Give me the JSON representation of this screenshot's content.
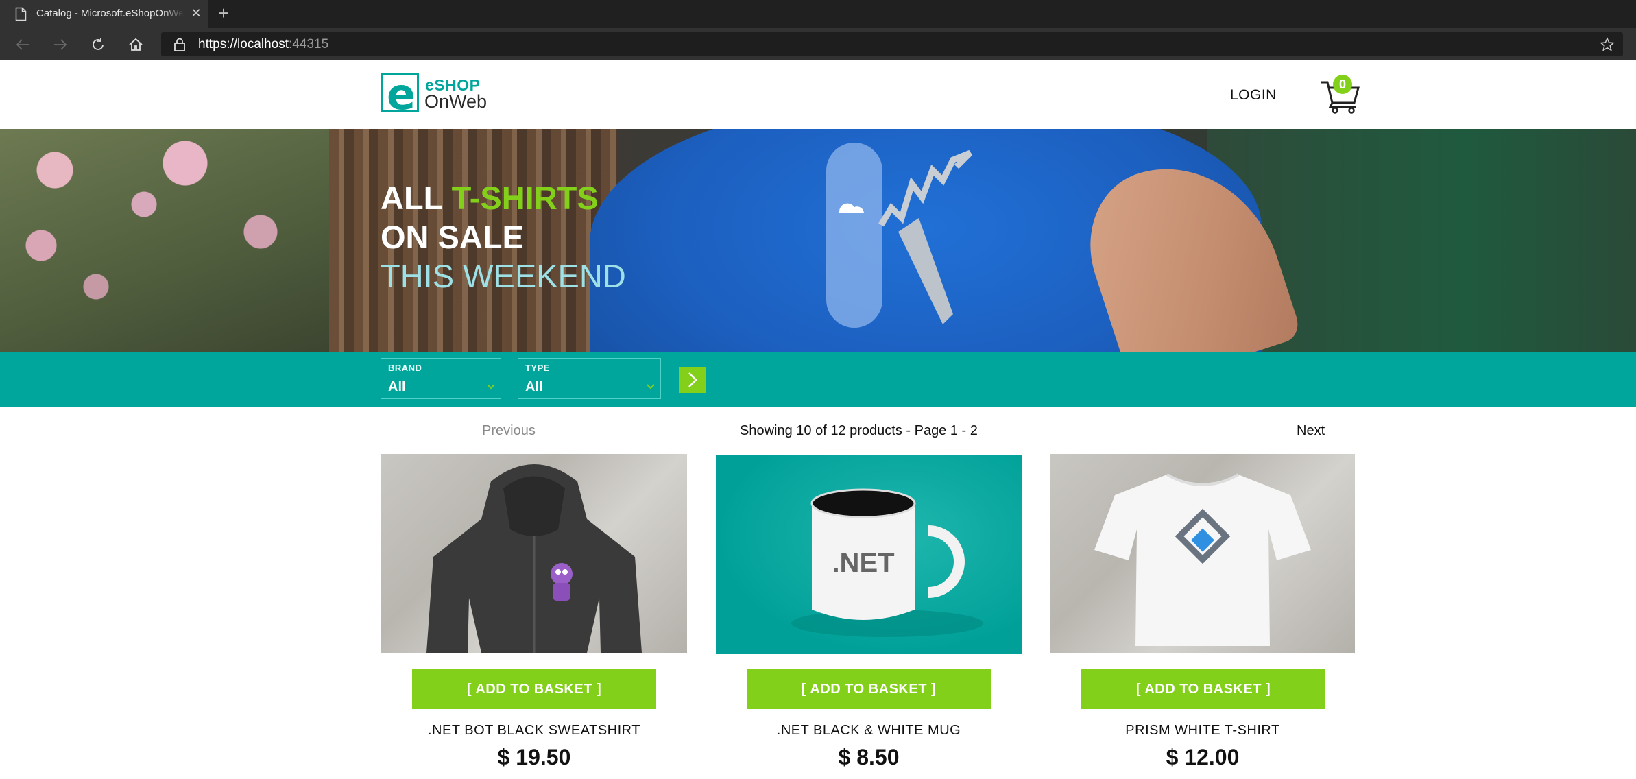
{
  "browser": {
    "tab_title": "Catalog - Microsoft.eShopOnWeb",
    "tab_close": "✕",
    "new_tab": "+",
    "url_host": "https://localhost",
    "url_port": ":44315"
  },
  "header": {
    "logo_top": "eSHOP",
    "logo_bottom": "OnWeb",
    "login_label": "LOGIN",
    "cart_count": "0"
  },
  "hero": {
    "line1_a": "ALL ",
    "line1_b": "T-SHIRTS",
    "line2": "ON SALE",
    "line3": "THIS WEEKEND"
  },
  "filters": {
    "brand_label": "BRAND",
    "brand_value": "All",
    "type_label": "TYPE",
    "type_value": "All"
  },
  "pager": {
    "previous": "Previous",
    "info": "Showing 10 of 12 products - Page 1 - 2",
    "next": "Next"
  },
  "products": [
    {
      "name": ".NET BOT BLACK SWEATSHIRT",
      "price": "$ 19.50",
      "add_label": "[ ADD TO BASKET ]",
      "image": "net-bot-black-sweatshirt"
    },
    {
      "name": ".NET BLACK & WHITE MUG",
      "price": "$ 8.50",
      "add_label": "[ ADD TO BASKET ]",
      "image": "net-black-white-mug",
      "mug_text": ".NET"
    },
    {
      "name": "PRISM WHITE T-SHIRT",
      "price": "$ 12.00",
      "add_label": "[ ADD TO BASKET ]",
      "image": "prism-white-tshirt"
    }
  ],
  "colors": {
    "teal": "#00a69c",
    "green": "#83d01b",
    "browser_dark": "#202020"
  }
}
